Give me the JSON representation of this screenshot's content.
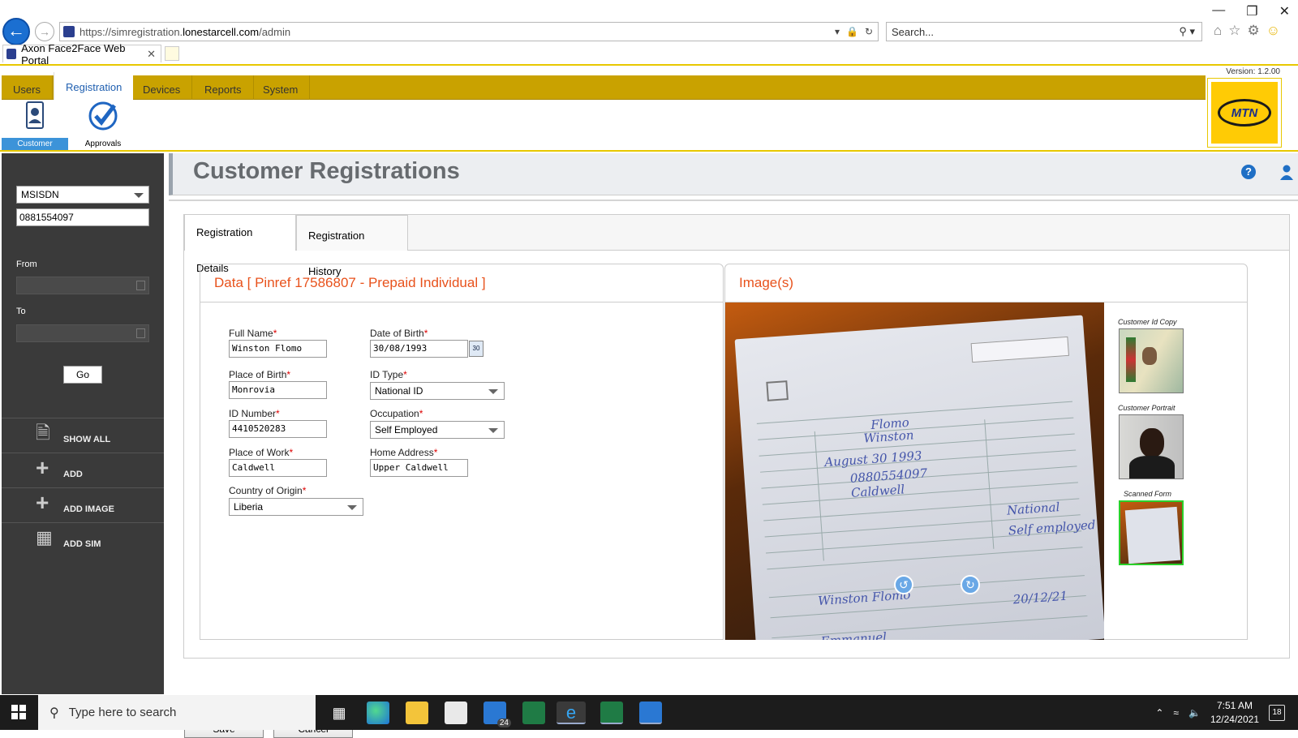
{
  "browser": {
    "url_prefix": "https://simregistration.",
    "url_domain": "lonestarcell.com",
    "url_suffix": "/admin",
    "search_placeholder": "Search...",
    "tab_title": "Axon Face2Face Web Portal"
  },
  "app": {
    "version": "Version: 1.2.00",
    "logo_text": "MTN",
    "menu": [
      "Users",
      "Registration",
      "Devices",
      "Reports",
      "System"
    ],
    "active_menu": "Registration",
    "sub_menu": [
      {
        "label": "Customer",
        "icon": "customer-id-icon",
        "selected": true
      },
      {
        "label": "Approvals",
        "icon": "checkmark-icon",
        "selected": false
      }
    ]
  },
  "sidebar": {
    "search_type": "MSISDN",
    "search_value": "0881554097",
    "from_label": "From",
    "to_label": "To",
    "go_label": "Go",
    "items": [
      {
        "label": "SHOW ALL",
        "icon": "document-icon"
      },
      {
        "label": "ADD",
        "icon": "plus-icon"
      },
      {
        "label": "ADD IMAGE",
        "icon": "plus-icon"
      },
      {
        "label": "ADD SIM",
        "icon": "sim-card-icon"
      }
    ]
  },
  "page": {
    "title": "Customer Registrations",
    "tabs": [
      "Registration Details",
      "Registration History"
    ],
    "active_tab": "Registration Details"
  },
  "form": {
    "heading": "Data [ Pinref 17586807 - Prepaid Individual ]",
    "full_name_label": "Full Name",
    "full_name": "Winston Flomo",
    "dob_label": "Date of Birth",
    "dob": "30/08/1993",
    "pob_label": "Place of Birth",
    "pob": "Monrovia",
    "id_type_label": "ID Type",
    "id_type": "National ID",
    "id_number_label": "ID Number",
    "id_number": "4410520283",
    "occupation_label": "Occupation",
    "occupation": "Self Employed",
    "pow_label": "Place of Work",
    "pow": "Caldwell",
    "home_label": "Home Address",
    "home": "Upper Caldwell",
    "country_label": "Country of Origin",
    "country": "Liberia",
    "required_marker": "*",
    "calendar_text": "30"
  },
  "images": {
    "heading": "Image(s)",
    "thumbnails": [
      {
        "label": "Customer Id Copy",
        "active": false
      },
      {
        "label": "Customer Portrait",
        "active": false
      },
      {
        "label": "Scanned Form",
        "active": true
      }
    ]
  },
  "actions": {
    "save": "Save",
    "cancel": "Cancel"
  },
  "taskbar": {
    "search_placeholder": "Type here to search",
    "mail_badge": "24",
    "time": "7:51 AM",
    "date": "12/24/2021",
    "notifications": "18"
  }
}
